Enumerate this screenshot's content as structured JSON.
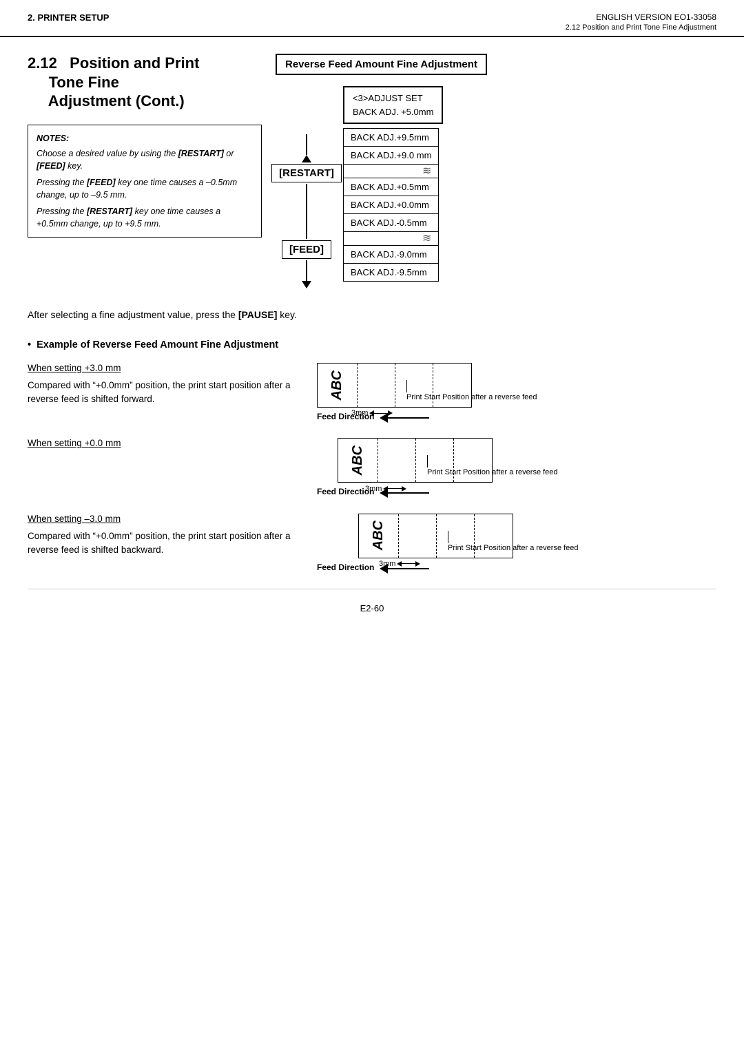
{
  "header": {
    "left": "2. PRINTER SETUP",
    "right_version": "ENGLISH VERSION EO1-33058",
    "right_subtitle": "2.12 Position and Print Tone Fine Adjustment"
  },
  "section": {
    "number": "2.12",
    "title_line1": "Position and Print",
    "title_line2": "Tone Fine",
    "title_line3": "Adjustment (Cont.)"
  },
  "diagram_title": "Reverse Feed Amount Fine Adjustment",
  "notes": {
    "title": "NOTES:",
    "line1": "Choose a desired value by using the",
    "key_restart": "[RESTART]",
    "or_feed": " or ",
    "key_feed": "[FEED]",
    "key_suffix": " key.",
    "line2_prefix": "Pressing the ",
    "key_feed2": "[FEED]",
    "line2_suffix": " key one time causes a –0.5mm change, up to –9.5 mm.",
    "line3_prefix": "Pressing the ",
    "key_restart2": "[RESTART]",
    "line3_suffix": " key one time causes a +0.5mm change, up to +9.5 mm."
  },
  "keys": {
    "restart": "[RESTART]",
    "feed": "[FEED]"
  },
  "top_menu": {
    "line1": "<3>ADJUST SET",
    "line2": "BACK ADJ. +5.0mm"
  },
  "menu_items": [
    {
      "label": "BACK ADJ.+9.5mm",
      "type": "normal"
    },
    {
      "label": "BACK ADJ.+9.0 mm",
      "type": "normal"
    },
    {
      "label": "squiggle",
      "type": "squiggle"
    },
    {
      "label": "BACK ADJ.+0.5mm",
      "type": "normal"
    },
    {
      "label": "BACK ADJ.+0.0mm",
      "type": "normal"
    },
    {
      "label": "BACK ADJ.-0.5mm",
      "type": "normal"
    },
    {
      "label": "squiggle",
      "type": "squiggle"
    },
    {
      "label": "BACK ADJ.-9.0mm",
      "type": "normal"
    },
    {
      "label": "BACK ADJ.-9.5mm",
      "type": "normal"
    }
  ],
  "after_selecting": {
    "text_prefix": "After selecting a fine adjustment value, press the ",
    "key_pause": "[PAUSE]",
    "text_suffix": " key."
  },
  "example_section": {
    "title": "Example of Reverse Feed Amount Fine Adjustment",
    "blocks": [
      {
        "setting": "When setting +3.0 mm",
        "desc": "Compared with “+0.0mm” position, the print start position after a reverse feed is shifted forward.",
        "feed_direction": "Feed Direction",
        "annotation": "Print Start Position after a reverse feed",
        "distance": "3mm"
      },
      {
        "setting": "When setting +0.0 mm",
        "desc": "",
        "feed_direction": "Feed Direction",
        "annotation": "Print Start Position after a reverse feed",
        "distance": "3mm"
      },
      {
        "setting": "When setting –3.0 mm",
        "desc": "Compared with “+0.0mm” position, the print start position after a reverse feed is shifted backward.",
        "feed_direction": "Feed Direction",
        "annotation": "Print Start Position after a reverse feed",
        "distance": "3mm"
      }
    ]
  },
  "footer": {
    "page": "E2-60"
  }
}
